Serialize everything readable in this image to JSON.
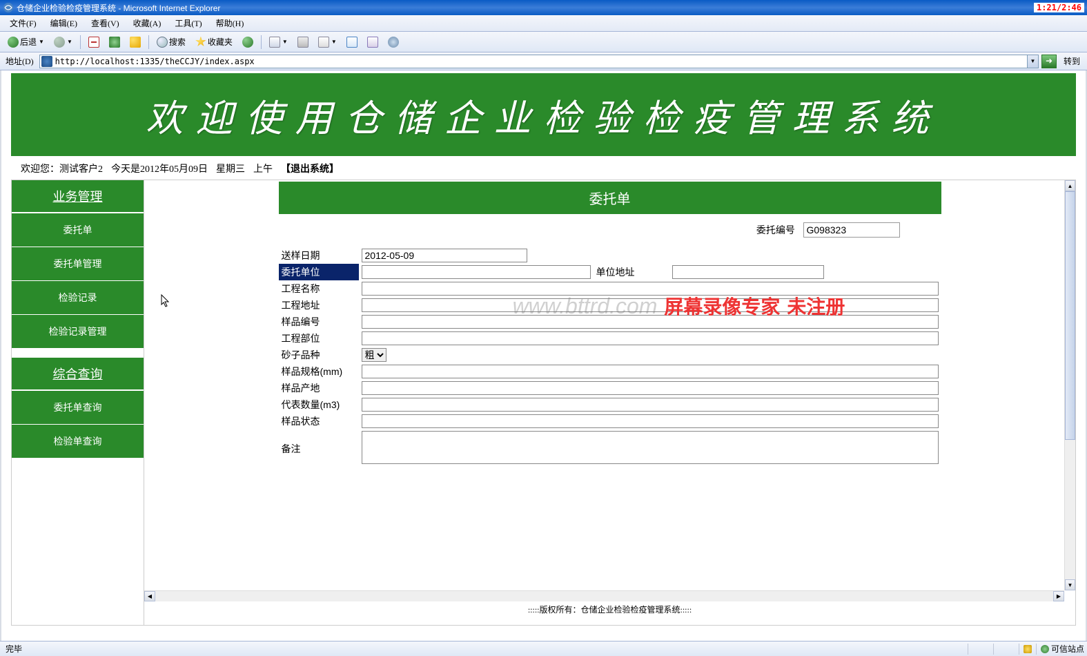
{
  "window": {
    "title": "仓储企业检验检疫管理系统 - Microsoft Internet Explorer",
    "clock": "1:21/2:46"
  },
  "menu": {
    "file": "文件(F)",
    "edit": "编辑(E)",
    "view": "查看(V)",
    "favorites": "收藏(A)",
    "tools": "工具(T)",
    "help": "帮助(H)"
  },
  "toolbar": {
    "back": "后退",
    "search": "搜索",
    "favorites": "收藏夹"
  },
  "address": {
    "label": "地址(D)",
    "url": "http://localhost:1335/theCCJY/index.aspx",
    "go": "转到"
  },
  "banner": {
    "text": "欢迎使用仓储企业检验检疫管理系统"
  },
  "welcome": {
    "prefix": "欢迎您：测试客户2",
    "date": "今天是2012年05月09日",
    "weekday": "星期三",
    "ampm": "上午",
    "logout": "【退出系统】"
  },
  "sidebar": {
    "head1": "业务管理",
    "items1": [
      "委托单",
      "委托单管理",
      "检验记录",
      "检验记录管理"
    ],
    "head2": "综合查询",
    "items2": [
      "委托单查询",
      "检验单查询"
    ]
  },
  "form": {
    "title": "委托单",
    "number_label": "委托编号",
    "number_value": "G098323",
    "labels": {
      "send_date": "送样日期",
      "client": "委托单位",
      "unit_addr": "单位地址",
      "project_name": "工程名称",
      "project_addr": "工程地址",
      "sample_no": "样品编号",
      "project_part": "工程部位",
      "sand_type": "砂子品种",
      "sample_spec": "样品规格(mm)",
      "sample_origin": "样品产地",
      "rep_qty": "代表数量(m3)",
      "sample_state": "样品状态",
      "remark": "备注"
    },
    "values": {
      "send_date": "2012-05-09",
      "client": "",
      "unit_addr": "",
      "project_name": "",
      "project_addr": "",
      "sample_no": "",
      "project_part": "",
      "sand_type": "粗",
      "sample_spec": "",
      "sample_origin": "",
      "rep_qty": "",
      "sample_state": "",
      "remark": ""
    }
  },
  "watermark": {
    "url": "www.bttrd.com",
    "text1": "屏幕录像专家",
    "text2": "未注册"
  },
  "footer": ":::::版权所有：仓储企业检验检疫管理系统:::::",
  "status": {
    "left": "完毕",
    "zone": "可信站点"
  }
}
